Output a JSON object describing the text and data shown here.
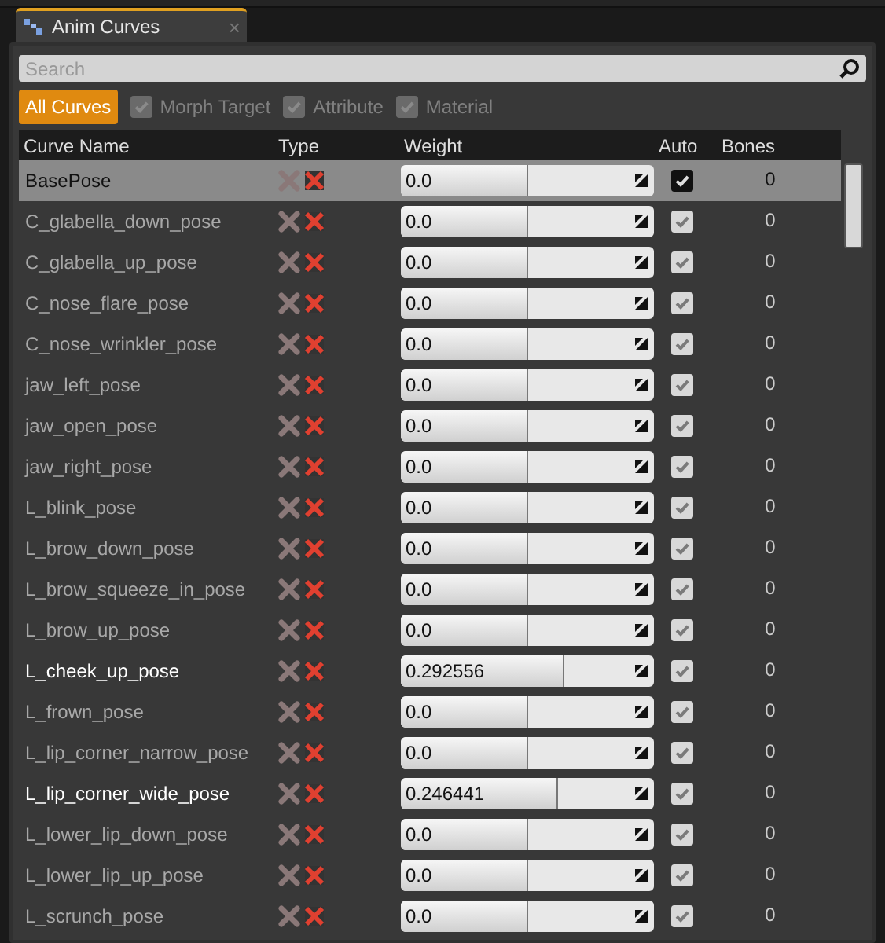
{
  "tab": {
    "title": "Anim Curves",
    "close": "×"
  },
  "search": {
    "placeholder": "Search"
  },
  "filters": [
    {
      "kind": "button",
      "label": "All Curves",
      "selected": true
    },
    {
      "kind": "check",
      "label": "Morph Target",
      "checked": true,
      "disabled": true
    },
    {
      "kind": "check",
      "label": "Attribute",
      "checked": true,
      "disabled": true
    },
    {
      "kind": "check",
      "label": "Material",
      "checked": true,
      "disabled": true
    }
  ],
  "table": {
    "columns": [
      "Curve Name",
      "Type",
      "Weight",
      "Auto",
      "Bones"
    ],
    "rows": [
      {
        "name": "BasePose",
        "selected": true,
        "active": false,
        "weight": "0.0",
        "level": 0.5,
        "auto": true,
        "bones": "0"
      },
      {
        "name": "C_glabella_down_pose",
        "selected": false,
        "active": false,
        "weight": "0.0",
        "level": 0.5,
        "auto": true,
        "bones": "0"
      },
      {
        "name": "C_glabella_up_pose",
        "selected": false,
        "active": false,
        "weight": "0.0",
        "level": 0.5,
        "auto": true,
        "bones": "0"
      },
      {
        "name": "C_nose_flare_pose",
        "selected": false,
        "active": false,
        "weight": "0.0",
        "level": 0.5,
        "auto": true,
        "bones": "0"
      },
      {
        "name": "C_nose_wrinkler_pose",
        "selected": false,
        "active": false,
        "weight": "0.0",
        "level": 0.5,
        "auto": true,
        "bones": "0"
      },
      {
        "name": "jaw_left_pose",
        "selected": false,
        "active": false,
        "weight": "0.0",
        "level": 0.5,
        "auto": true,
        "bones": "0"
      },
      {
        "name": "jaw_open_pose",
        "selected": false,
        "active": false,
        "weight": "0.0",
        "level": 0.5,
        "auto": true,
        "bones": "0"
      },
      {
        "name": "jaw_right_pose",
        "selected": false,
        "active": false,
        "weight": "0.0",
        "level": 0.5,
        "auto": true,
        "bones": "0"
      },
      {
        "name": "L_blink_pose",
        "selected": false,
        "active": false,
        "weight": "0.0",
        "level": 0.5,
        "auto": true,
        "bones": "0"
      },
      {
        "name": "L_brow_down_pose",
        "selected": false,
        "active": false,
        "weight": "0.0",
        "level": 0.5,
        "auto": true,
        "bones": "0"
      },
      {
        "name": "L_brow_squeeze_in_pose",
        "selected": false,
        "active": false,
        "weight": "0.0",
        "level": 0.5,
        "auto": true,
        "bones": "0"
      },
      {
        "name": "L_brow_up_pose",
        "selected": false,
        "active": false,
        "weight": "0.0",
        "level": 0.5,
        "auto": true,
        "bones": "0"
      },
      {
        "name": "L_cheek_up_pose",
        "selected": false,
        "active": true,
        "weight": "0.292556",
        "level": 0.646,
        "auto": true,
        "bones": "0"
      },
      {
        "name": "L_frown_pose",
        "selected": false,
        "active": false,
        "weight": "0.0",
        "level": 0.5,
        "auto": true,
        "bones": "0"
      },
      {
        "name": "L_lip_corner_narrow_pose",
        "selected": false,
        "active": false,
        "weight": "0.0",
        "level": 0.5,
        "auto": true,
        "bones": "0"
      },
      {
        "name": "L_lip_corner_wide_pose",
        "selected": false,
        "active": true,
        "weight": "0.246441",
        "level": 0.623,
        "auto": true,
        "bones": "0"
      },
      {
        "name": "L_lower_lip_down_pose",
        "selected": false,
        "active": false,
        "weight": "0.0",
        "level": 0.5,
        "auto": true,
        "bones": "0"
      },
      {
        "name": "L_lower_lip_up_pose",
        "selected": false,
        "active": false,
        "weight": "0.0",
        "level": 0.5,
        "auto": true,
        "bones": "0"
      },
      {
        "name": "L_scrunch_pose",
        "selected": false,
        "active": false,
        "weight": "0.0",
        "level": 0.5,
        "auto": true,
        "bones": "0"
      }
    ]
  }
}
